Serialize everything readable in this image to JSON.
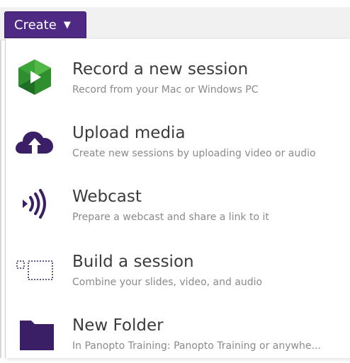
{
  "toolbar": {
    "create_label": "Create",
    "caret": "▼"
  },
  "menu": {
    "items": [
      {
        "title": "Record a new session",
        "desc": "Record from your Mac or Windows PC",
        "icon": "panopto-record-icon"
      },
      {
        "title": "Upload media",
        "desc": "Create new sessions by uploading video or audio",
        "icon": "cloud-upload-icon"
      },
      {
        "title": "Webcast",
        "desc": "Prepare a webcast and share a link to it",
        "icon": "broadcast-icon"
      },
      {
        "title": "Build a session",
        "desc": "Combine your slides, video, and audio",
        "icon": "build-session-icon"
      },
      {
        "title": "New Folder",
        "desc": "In Panopto Training: Panopto Training or anywhe...",
        "icon": "folder-icon"
      }
    ]
  },
  "colors": {
    "accent": "#4e2a84",
    "icon_purple": "#3a1f66",
    "record_green": "#3aa63a"
  }
}
